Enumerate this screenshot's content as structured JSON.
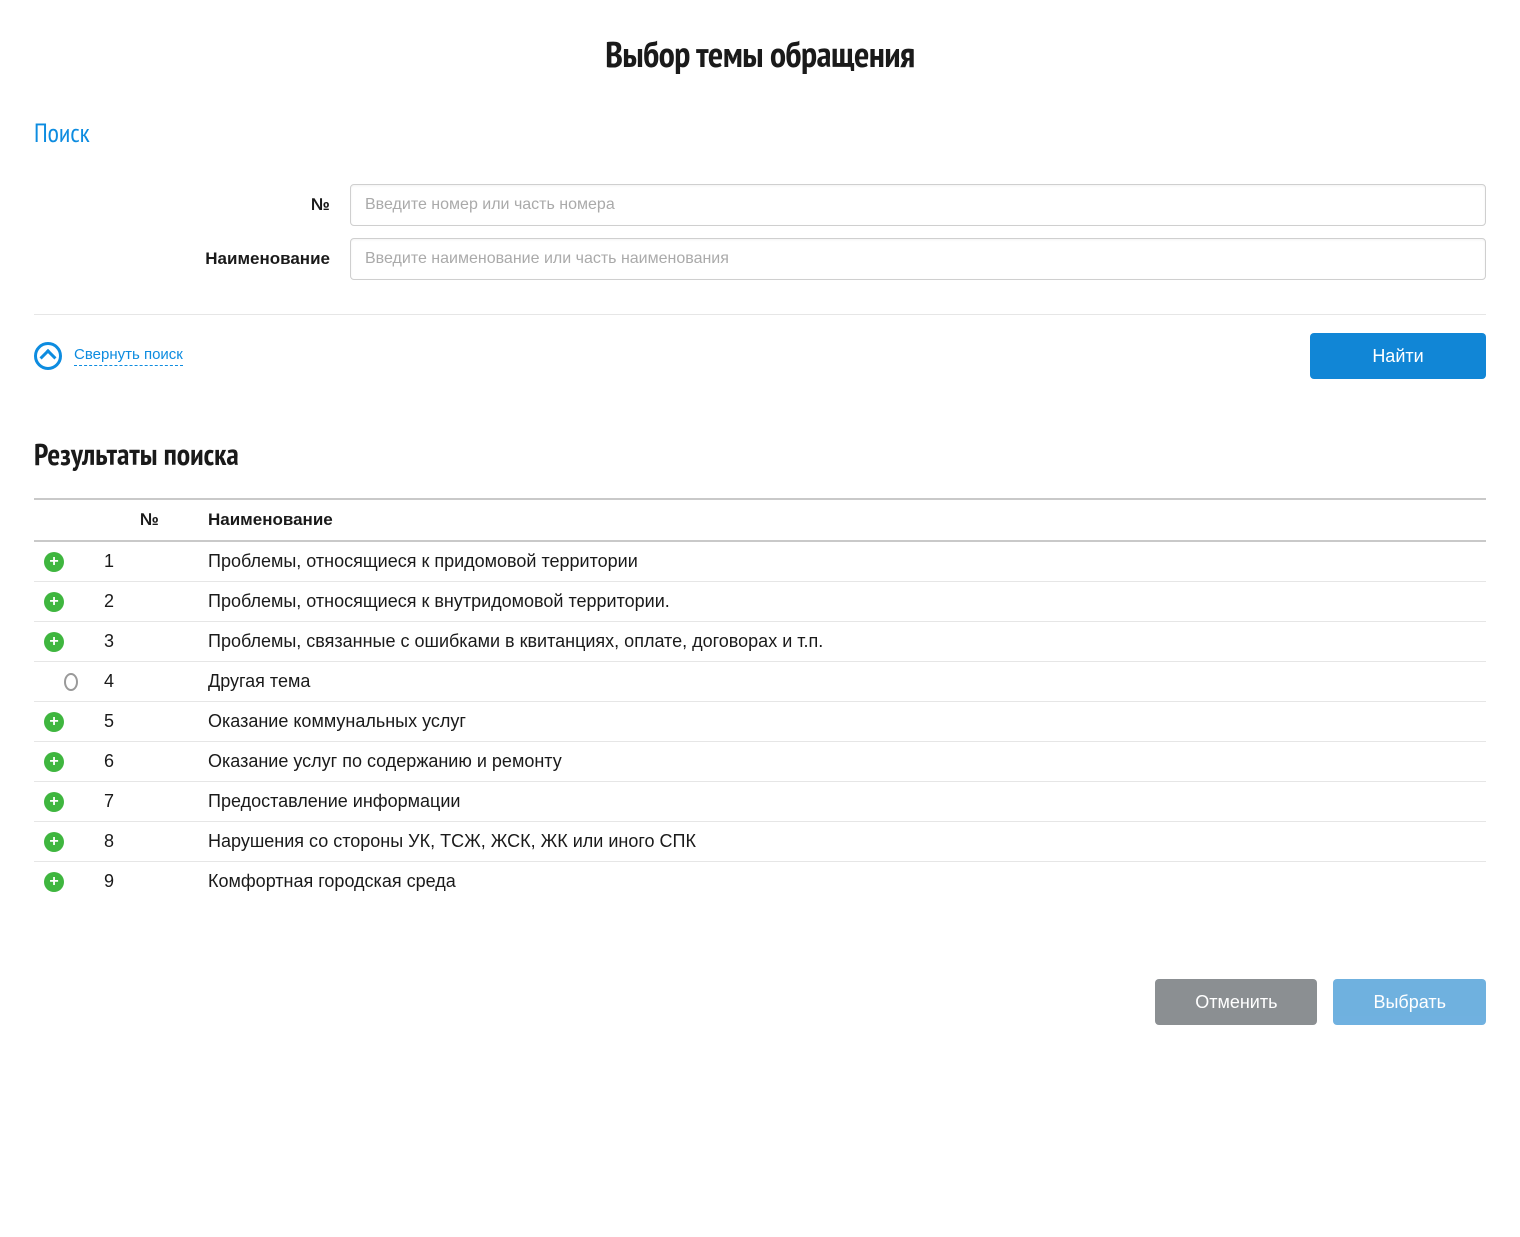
{
  "page_title": "Выбор темы обращения",
  "search": {
    "section_label": "Поиск",
    "number_label": "№",
    "number_placeholder": "Введите номер или часть номера",
    "name_label": "Наименование",
    "name_placeholder": "Введите наименование или часть наименования",
    "collapse_label": "Свернуть поиск",
    "find_button": "Найти"
  },
  "results": {
    "section_label": "Результаты поиска",
    "headers": {
      "number": "№",
      "name": "Наименование"
    },
    "rows": [
      {
        "type": "expand",
        "number": "1",
        "name": "Проблемы, относящиеся к придомовой территории"
      },
      {
        "type": "expand",
        "number": "2",
        "name": "Проблемы, относящиеся к внутридомовой территории."
      },
      {
        "type": "expand",
        "number": "3",
        "name": "Проблемы, связанные с ошибками в квитанциях, оплате, договорах и т.п."
      },
      {
        "type": "radio",
        "number": "4",
        "name": "Другая тема"
      },
      {
        "type": "expand",
        "number": "5",
        "name": "Оказание коммунальных услуг"
      },
      {
        "type": "expand",
        "number": "6",
        "name": "Оказание услуг по содержанию и ремонту"
      },
      {
        "type": "expand",
        "number": "7",
        "name": "Предоставление информации"
      },
      {
        "type": "expand",
        "number": "8",
        "name": "Нарушения со стороны УК, ТСЖ, ЖСК, ЖК или иного СПК"
      },
      {
        "type": "expand",
        "number": "9",
        "name": "Комфортная городская среда"
      }
    ]
  },
  "footer": {
    "cancel": "Отменить",
    "select": "Выбрать"
  }
}
